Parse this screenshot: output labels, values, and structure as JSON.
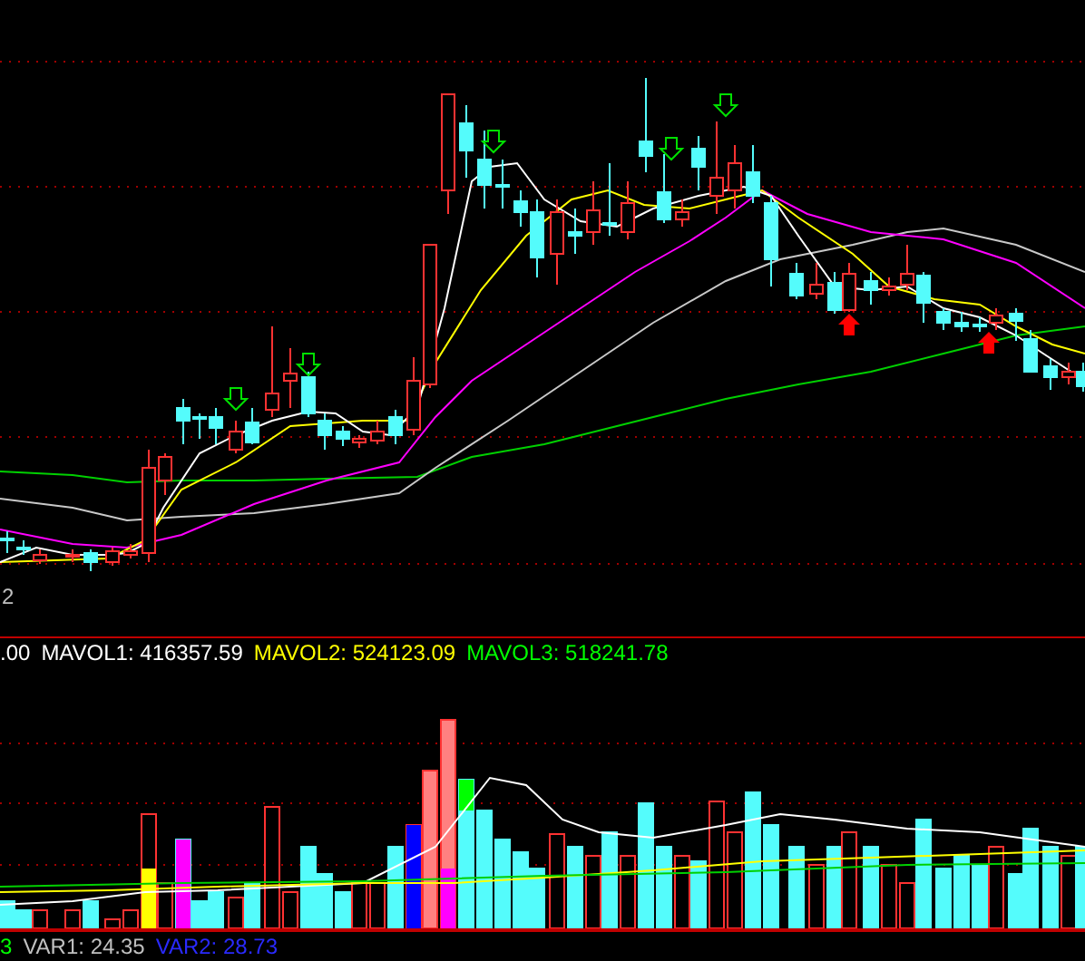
{
  "price_panel": {
    "axis_label": "2"
  },
  "volume_legend": [
    {
      "text": ".00",
      "color": "#ffffff"
    },
    {
      "text": "MAVOL1: 416357.59",
      "color": "#ffffff"
    },
    {
      "text": "MAVOL2: 524123.09",
      "color": "#ffff00"
    },
    {
      "text": "MAVOL3: 518241.78",
      "color": "#00ff00"
    }
  ],
  "indicator_legend": [
    {
      "text": "3",
      "color": "#00ff00"
    },
    {
      "text": "VAR1: 24.35",
      "color": "#c0c0c0"
    },
    {
      "text": "VAR2: 28.73",
      "color": "#2a2aff"
    }
  ]
}
